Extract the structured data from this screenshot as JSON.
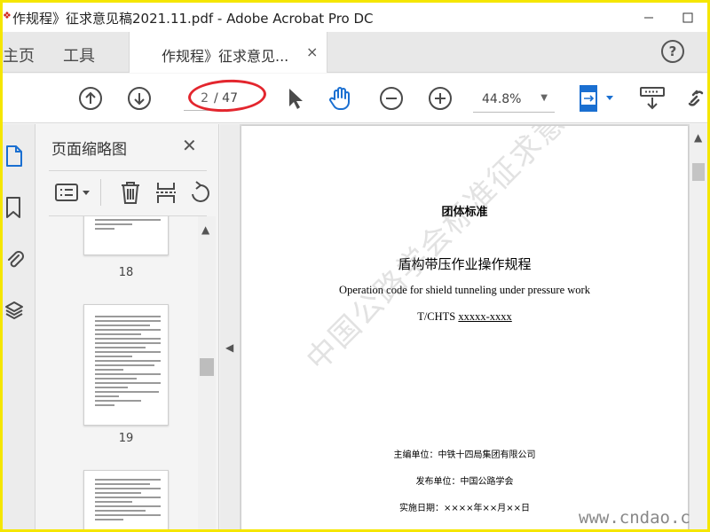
{
  "window": {
    "title": "作规程》征求意见稿2021.11.pdf - Adobe Acrobat Pro DC"
  },
  "tabs": {
    "home": "主页",
    "tools": "工具",
    "document": "作规程》征求意见...",
    "close": "×",
    "help": "?"
  },
  "toolbar": {
    "current_page": "2",
    "page_total": "/ 47",
    "zoom": "44.8%"
  },
  "thumbnails": {
    "title": "页面缩略图",
    "close": "✕",
    "pages": [
      {
        "number": "18"
      },
      {
        "number": "19"
      }
    ]
  },
  "document": {
    "standard_label": "团体标准",
    "title_cn": "盾构带压作业操作规程",
    "title_en": "Operation code for shield tunneling under pressure work",
    "code_prefix": "T/CHTS ",
    "code_value": "xxxxx-xxxx",
    "editor_org": "主编单位：中铁十四局集团有限公司",
    "publisher": "发布单位：中国公路学会",
    "date": "实施日期：××××年××月××日",
    "watermark": "中国公路学会标准征求意见稿"
  },
  "site_watermark": "www.cndao.com",
  "colors": {
    "frame": "#f5e600",
    "accent_blue": "#1a6fd1",
    "annotation_red": "#e3262e"
  }
}
